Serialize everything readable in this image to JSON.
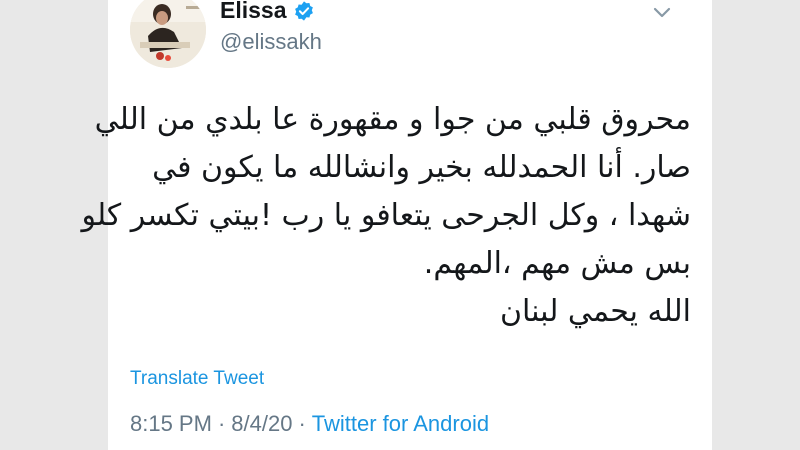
{
  "author": {
    "display_name": "Elissa",
    "handle": "@elissakh",
    "verified": true
  },
  "icons": {
    "verified": "verified-badge-icon",
    "menu": "chevron-down-icon"
  },
  "tweet": {
    "lines": [
      "محروق قلبي من جوا و مقهورة عا بلدي من اللي",
      "صار. أنا الحمدلله بخير وانشالله ما يكون في",
      "شهدا ، وكل الجرحى يتعافو يا رب !بيتي تكسر كلو",
      "بس مش مهم ،المهم.",
      "الله يحمي لبنان"
    ]
  },
  "translate_label": "Translate Tweet",
  "meta": {
    "time": "8:15 PM",
    "separator": "·",
    "date": "8/4/20",
    "source": "Twitter for Android"
  },
  "colors": {
    "link": "#1b95e0",
    "secondary_text": "#657786",
    "primary_text": "#14171a",
    "verified": "#1da1f2"
  }
}
